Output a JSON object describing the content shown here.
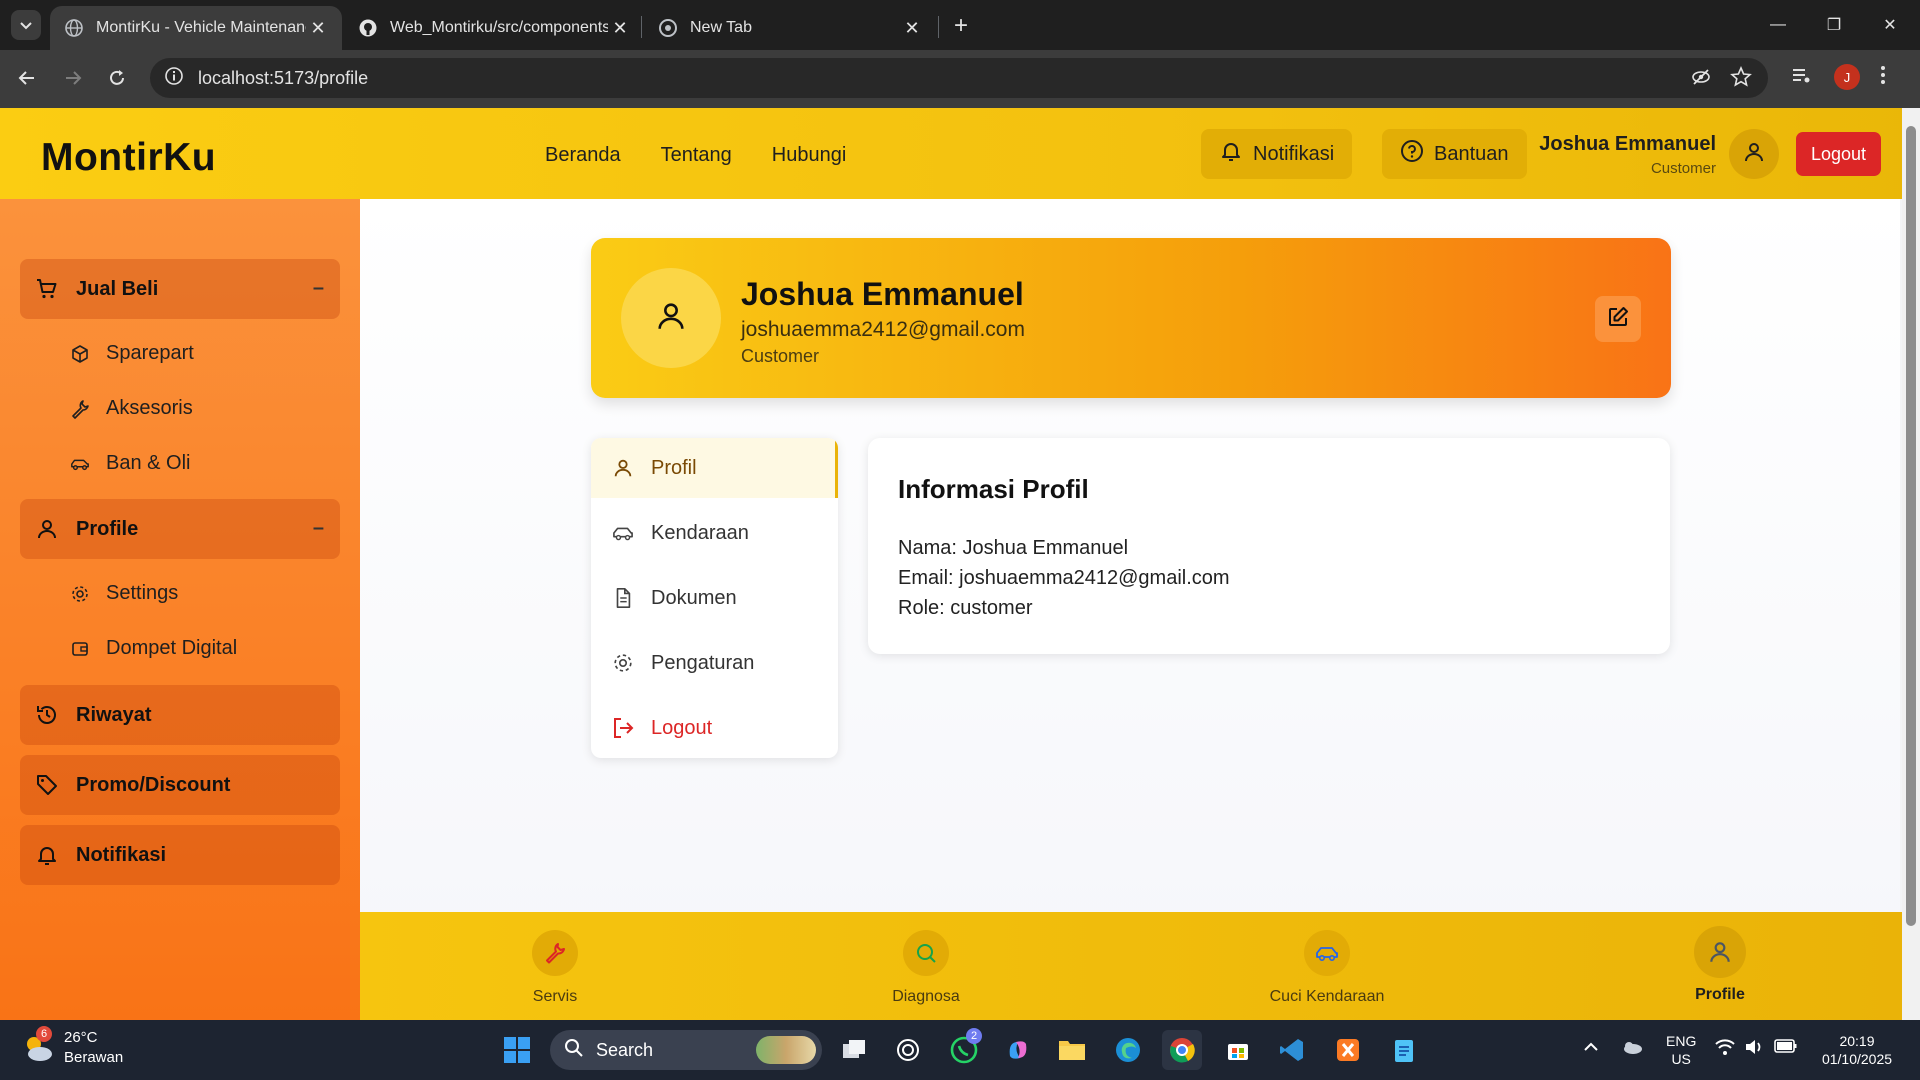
{
  "browser": {
    "tabs": [
      {
        "title": "MontirKu - Vehicle Maintenance"
      },
      {
        "title": "Web_Montirku/src/components"
      },
      {
        "title": "New Tab"
      }
    ],
    "url": "localhost:5173/profile",
    "profile_initial": "J"
  },
  "header": {
    "brand": "MontirKu",
    "nav": [
      "Beranda",
      "Tentang",
      "Hubungi"
    ],
    "notif_label": "Notifikasi",
    "help_label": "Bantuan",
    "user_name": "Joshua Emmanuel",
    "user_role": "Customer",
    "logout_label": "Logout"
  },
  "sidebar": {
    "groups": {
      "jual_beli": {
        "label": "Jual Beli",
        "toggle": "–",
        "items": [
          "Sparepart",
          "Aksesoris",
          "Ban & Oli"
        ]
      },
      "profile": {
        "label": "Profile",
        "toggle": "–",
        "items": [
          "Settings",
          "Dompet Digital"
        ]
      },
      "riwayat": {
        "label": "Riwayat"
      },
      "promo": {
        "label": "Promo/Discount"
      },
      "notifikasi": {
        "label": "Notifikasi"
      }
    }
  },
  "profile_card": {
    "name": "Joshua Emmanuel",
    "email": "joshuaemma2412@gmail.com",
    "role": "Customer"
  },
  "profile_menu": [
    "Profil",
    "Kendaraan",
    "Dokumen",
    "Pengaturan",
    "Logout"
  ],
  "info": {
    "title": "Informasi Profil",
    "nama": "Nama: Joshua Emmanuel",
    "email": "Email: joshuaemma2412@gmail.com",
    "role": "Role: customer"
  },
  "bottom_nav": [
    "Servis",
    "Diagnosa",
    "Cuci Kendaraan",
    "Profile"
  ],
  "taskbar": {
    "weather_badge": "6",
    "temperature": "26°C",
    "weather_desc": "Berawan",
    "search_label": "Search",
    "whatsapp_badge": "2",
    "lang_line1": "ENG",
    "lang_line2": "US",
    "time": "20:19",
    "date": "01/10/2025"
  },
  "colors": {
    "header_yellow": "#facc15",
    "sidebar_orange": "#f97316",
    "logout_red": "#dc2626"
  }
}
